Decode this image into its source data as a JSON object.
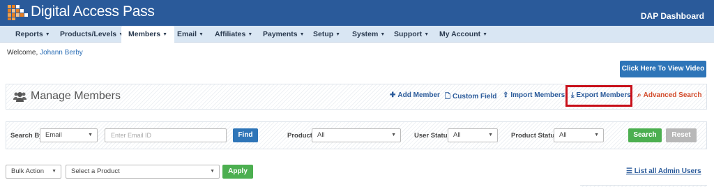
{
  "header": {
    "logo_text": "Digital Access Pass",
    "dashboard_title": "DAP Dashboard"
  },
  "nav": {
    "items": [
      {
        "label": "Reports"
      },
      {
        "label": "Products/Levels"
      },
      {
        "label": "Members"
      },
      {
        "label": "Email"
      },
      {
        "label": "Affiliates"
      },
      {
        "label": "Payments"
      },
      {
        "label": "Setup"
      },
      {
        "label": "System"
      },
      {
        "label": "Support"
      },
      {
        "label": "My Account"
      }
    ],
    "active": "Members",
    "caret": "▼"
  },
  "welcome": {
    "prefix": "Welcome,",
    "user": "Johann Berby"
  },
  "video_button": "Click Here To View Video",
  "manage": {
    "title": "Manage Members",
    "actions": {
      "add_member": "Add Member",
      "custom_field": "Custom Field",
      "import_members": "Import Members",
      "export_members": "Export Members",
      "advanced_search": "Advanced Search"
    },
    "highlight_color": "#c8101a"
  },
  "search": {
    "search_by_label": "Search By",
    "search_by_value": "Email",
    "email_placeholder": "Enter Email ID",
    "find_button": "Find",
    "product_label": "Product",
    "product_value": "All",
    "user_status_label": "User Status",
    "user_status_value": "All",
    "product_status_label": "Product Status",
    "product_status_value": "All",
    "search_button": "Search",
    "reset_button": "Reset"
  },
  "bulk": {
    "bulk_action": "Bulk Action",
    "select_product": "Select a Product",
    "apply_button": "Apply",
    "list_admin_users": "List all Admin Users"
  },
  "colors": {
    "header_bg": "#2a5a9a",
    "nav_bg": "#d9e6f3",
    "primary_button": "#2e75b8",
    "success_button": "#4caf50",
    "disabled_button": "#b8b8b8"
  }
}
